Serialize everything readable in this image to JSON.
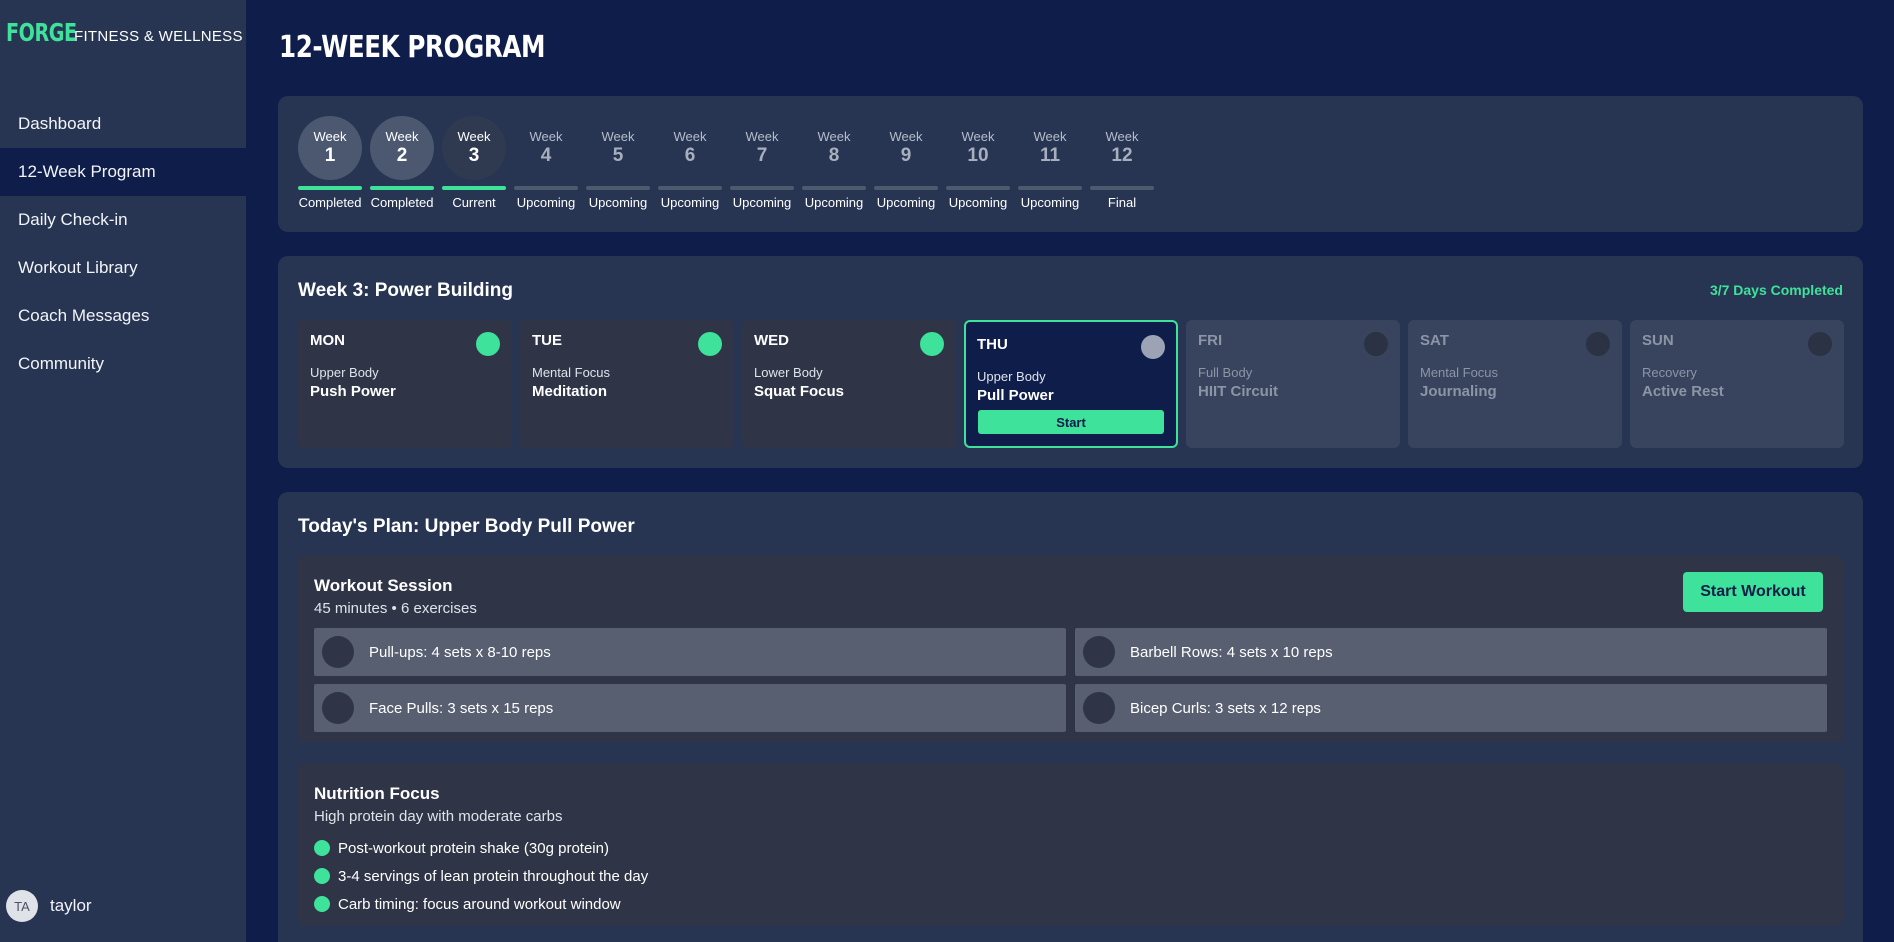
{
  "brand": {
    "logo": "FORGE",
    "subtitle": "FITNESS & WELLNESS"
  },
  "nav": [
    {
      "label": "Dashboard"
    },
    {
      "label": "12-Week Program"
    },
    {
      "label": "Daily Check-in"
    },
    {
      "label": "Workout Library"
    },
    {
      "label": "Coach Messages"
    },
    {
      "label": "Community"
    }
  ],
  "user": {
    "initials": "TA",
    "name": "taylor"
  },
  "page": {
    "title": "12-WEEK PROGRAM"
  },
  "weeks": [
    {
      "word": "Week",
      "number": "1",
      "status": "Completed"
    },
    {
      "word": "Week",
      "number": "2",
      "status": "Completed"
    },
    {
      "word": "Week",
      "number": "3",
      "status": "Current"
    },
    {
      "word": "Week",
      "number": "4",
      "status": "Upcoming"
    },
    {
      "word": "Week",
      "number": "5",
      "status": "Upcoming"
    },
    {
      "word": "Week",
      "number": "6",
      "status": "Upcoming"
    },
    {
      "word": "Week",
      "number": "7",
      "status": "Upcoming"
    },
    {
      "word": "Week",
      "number": "8",
      "status": "Upcoming"
    },
    {
      "word": "Week",
      "number": "9",
      "status": "Upcoming"
    },
    {
      "word": "Week",
      "number": "10",
      "status": "Upcoming"
    },
    {
      "word": "Week",
      "number": "11",
      "status": "Upcoming"
    },
    {
      "word": "Week",
      "number": "12",
      "status": "Final"
    }
  ],
  "week_plan": {
    "heading": "Week 3: Power Building",
    "completed": "3/7 Days Completed",
    "days": [
      {
        "name": "MON",
        "category": "Upper Body",
        "title": "Push Power"
      },
      {
        "name": "TUE",
        "category": "Mental Focus",
        "title": "Meditation"
      },
      {
        "name": "WED",
        "category": "Lower Body",
        "title": "Squat Focus"
      },
      {
        "name": "THU",
        "category": "Upper Body",
        "title": "Pull Power",
        "button": "Start"
      },
      {
        "name": "FRI",
        "category": "Full Body",
        "title": "HIIT Circuit"
      },
      {
        "name": "SAT",
        "category": "Mental Focus",
        "title": "Journaling"
      },
      {
        "name": "SUN",
        "category": "Recovery",
        "title": "Active Rest"
      }
    ]
  },
  "today": {
    "heading": "Today's Plan: Upper Body Pull Power",
    "session": {
      "title": "Workout Session",
      "subtitle": "45 minutes • 6 exercises",
      "button": "Start Workout",
      "exercises": [
        "Pull-ups: 4 sets x 8-10 reps",
        "Barbell Rows: 4 sets x 10 reps",
        "Face Pulls: 3 sets x 15 reps",
        "Bicep Curls: 3 sets x 12 reps"
      ]
    },
    "nutrition": {
      "title": "Nutrition Focus",
      "subtitle": "High protein day with moderate carbs",
      "items": [
        "Post-workout protein shake (30g protein)",
        "3-4 servings of lean protein throughout the day",
        "Carb timing: focus around workout window"
      ]
    }
  },
  "colors": {
    "accent": "#3ee29a",
    "background": "#0f1d4a",
    "card": "#273553"
  }
}
